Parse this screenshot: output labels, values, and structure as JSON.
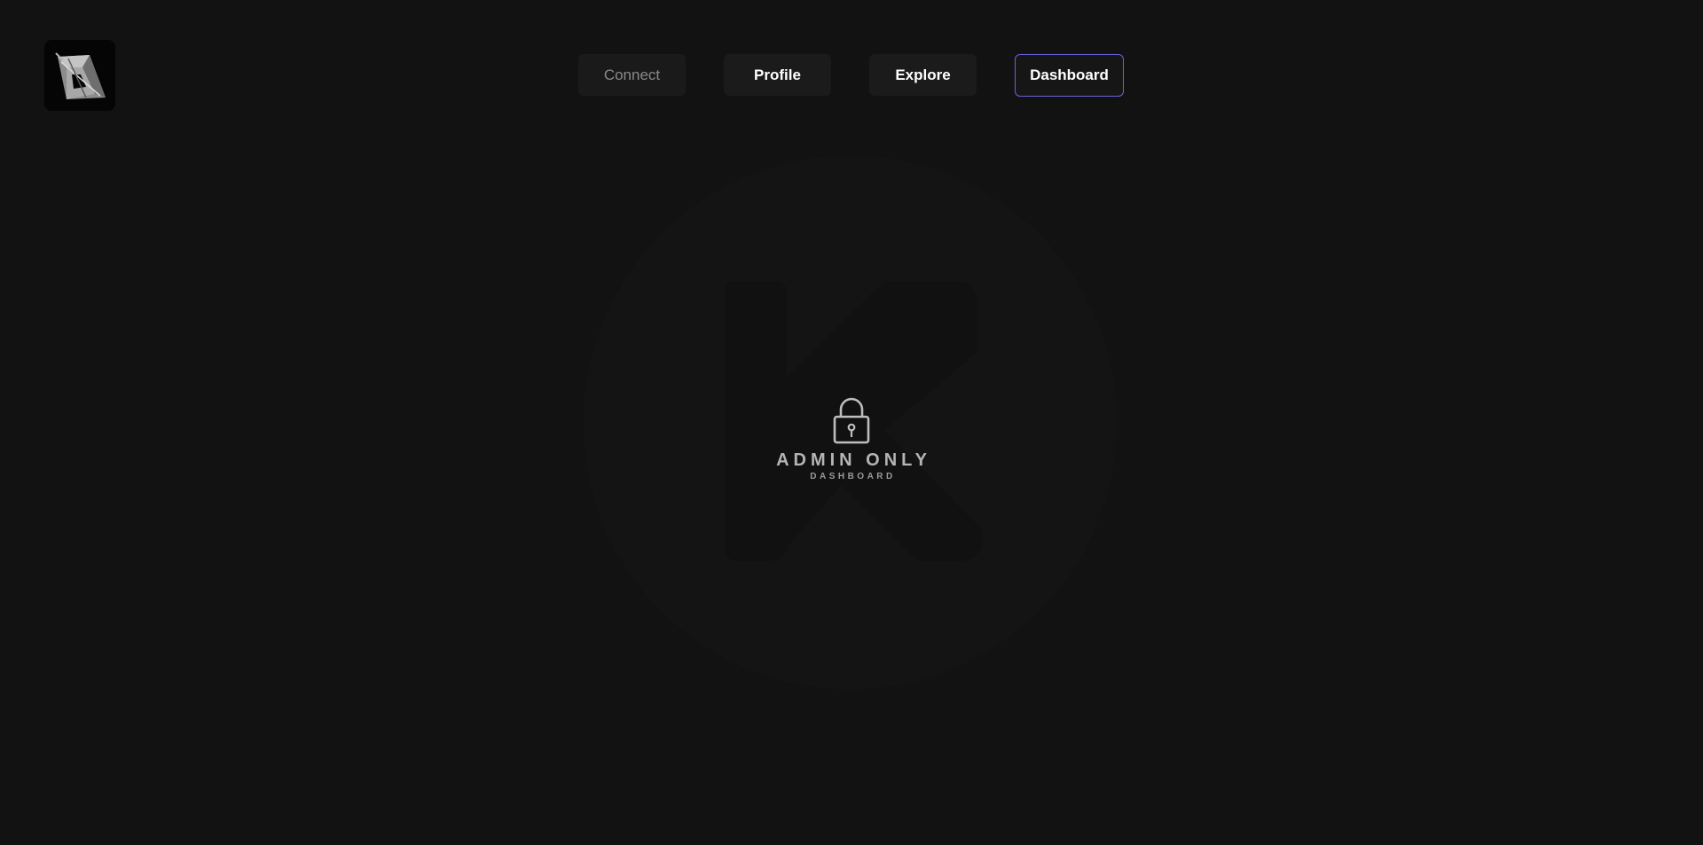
{
  "header": {
    "logo_icon": "triangle-logo-icon"
  },
  "nav": {
    "items": [
      {
        "label": "Connect",
        "state": "disabled"
      },
      {
        "label": "Profile",
        "state": "default"
      },
      {
        "label": "Explore",
        "state": "default"
      },
      {
        "label": "Dashboard",
        "state": "active"
      }
    ]
  },
  "main": {
    "watermark_icon": "k-circle-watermark-icon",
    "lock_icon": "lock-icon",
    "title": "ADMIN ONLY",
    "subtitle": "DASHBOARD"
  },
  "colors": {
    "background": "#121212",
    "button_bg": "#1b1b1b",
    "active_border": "#6a63d8",
    "muted_text": "#8a8a8a"
  }
}
